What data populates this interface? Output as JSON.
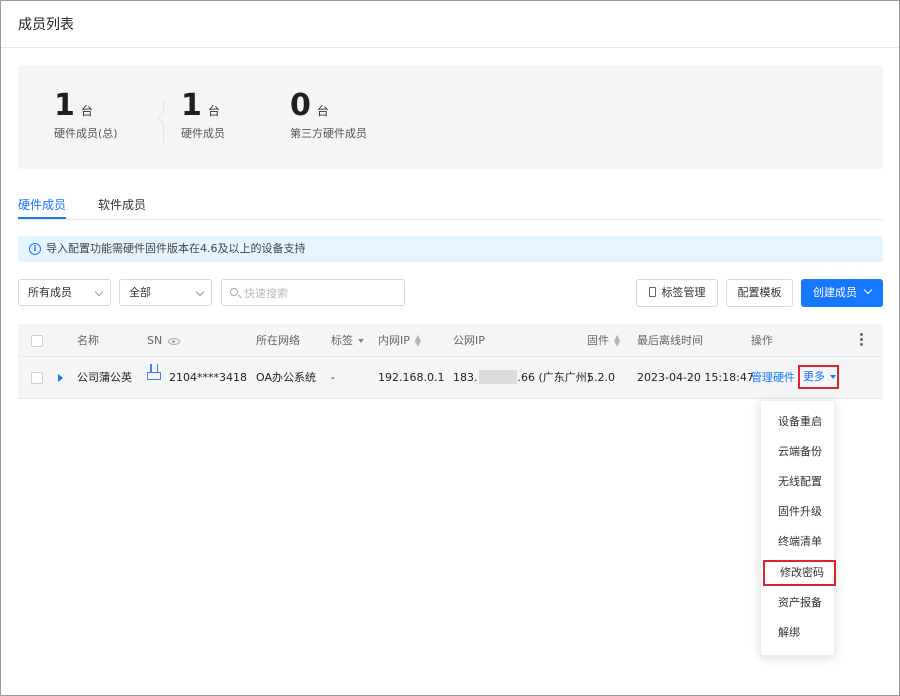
{
  "page": {
    "title": "成员列表"
  },
  "summary": {
    "stats": [
      {
        "value": "1",
        "unit": "台",
        "label": "硬件成员(总)"
      },
      {
        "value": "1",
        "unit": "台",
        "label": "硬件成员"
      },
      {
        "value": "0",
        "unit": "台",
        "label": "第三方硬件成员"
      }
    ]
  },
  "tabs": [
    {
      "label": "硬件成员",
      "active": true
    },
    {
      "label": "软件成员",
      "active": false
    }
  ],
  "notice": {
    "icon": "info-icon",
    "text": "导入配置功能需硬件固件版本在4.6及以上的设备支持"
  },
  "filters": {
    "member_type": "所有成员",
    "scope": "全部",
    "search_placeholder": "快速搜索"
  },
  "toolbar": {
    "tag_manage": "标签管理",
    "config_template": "配置模板",
    "create_member": "创建成员"
  },
  "table": {
    "columns": {
      "name": "名称",
      "sn": "SN",
      "network": "所在网络",
      "tag": "标签",
      "lan_ip": "内网IP",
      "public_ip": "公网IP",
      "firmware": "固件",
      "last_offline": "最后离线时间",
      "actions": "操作"
    },
    "rows": [
      {
        "name": "公司蒲公英",
        "device_icon": "router-icon",
        "sn": "2104****3418",
        "network": "OA办公系统",
        "tag": "-",
        "lan_ip": "192.168.0.1",
        "public_ip_prefix": "183.",
        "public_ip_suffix": ".66 (广东广州)",
        "firmware": "5.2.0",
        "last_offline": "2023-04-20 15:18:47",
        "manage_label": "管理硬件",
        "more_label": "更多"
      }
    ]
  },
  "more_menu": {
    "items": [
      "设备重启",
      "云端备份",
      "无线配置",
      "固件升级",
      "终端清单",
      "修改密码",
      "资产报备",
      "解绑"
    ],
    "highlighted": "修改密码"
  },
  "colors": {
    "accent": "#1677ff",
    "highlight_border": "#e0242b",
    "panel_bg": "#f4f5f6",
    "notice_bg": "#e6f4ff"
  }
}
